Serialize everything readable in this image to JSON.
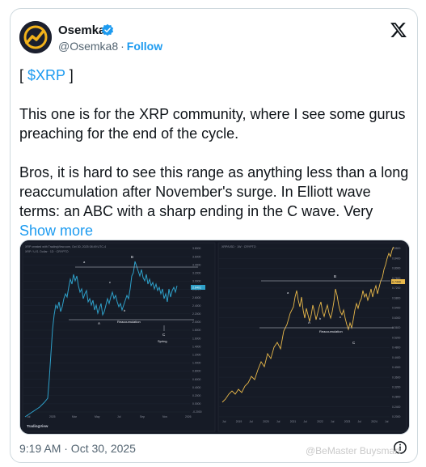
{
  "author": {
    "name": "Osemka",
    "handle": "@Osemka8",
    "separator": "·",
    "follow_label": "Follow"
  },
  "tweet": {
    "cashtag_open": "[ ",
    "cashtag": "$XRP",
    "cashtag_close": " ]",
    "paragraph_1": "This one is for the XRP community, where I see some gurus preaching for the end of the cycle.",
    "paragraph_2": "Bros, it is hard to see this range as anything less than a long reaccumulation after November's surge. In Elliott wave terms: an ABC with a sharp ending in the C wave. Very ",
    "show_more_label": "Show more"
  },
  "timestamp": "9:19 AM · Oct 30, 2025",
  "watermark": "@BeMaster Buysmart",
  "chart_left": {
    "header": "XRP created with TradingView.com, Oct 30, 2025 08:49 UTC-4",
    "symbol": "XRP / U.S. Dollar · 1D · CRYPTO",
    "labels": {
      "A": "A",
      "B": "B",
      "C": "C",
      "a": "a",
      "b": "b",
      "c": "c",
      "reacc": "Reaccumulation",
      "spring": "Spring"
    },
    "x_ticks": [
      "Jul",
      "2025",
      "Mar",
      "May",
      "Jul",
      "Sep",
      "Nov",
      "2026"
    ],
    "y_ticks": [
      "3.8000",
      "3.6000",
      "3.4000",
      "3.2000",
      "3.0000",
      "2.8000",
      "2.6000",
      "2.4000",
      "2.2000",
      "2.0000",
      "1.8000",
      "1.6000",
      "1.4000",
      "1.2000",
      "1.0000",
      "0.8000",
      "0.6000",
      "0.4000",
      "0.2000",
      "0.0000",
      "-0.2000"
    ],
    "price_tag": "2.6401",
    "brand": "TradingView"
  },
  "chart_right": {
    "header": "XRP/USD · 1W · CRYPTO",
    "labels": {
      "A": "A",
      "B": "B",
      "C": "C",
      "a": "a",
      "b": "b",
      "c": "c",
      "reacc": "Reaccumulation"
    },
    "x_ticks": [
      "Jul",
      "2019",
      "Jul",
      "2020",
      "Jul",
      "2021",
      "Jul",
      "2022",
      "Jul",
      "2023",
      "Jul",
      "2024",
      "Jul"
    ],
    "y_ticks": [
      "0.8800",
      "0.8400",
      "0.8000",
      "0.7600",
      "0.7200",
      "0.6800",
      "0.6400",
      "0.6000",
      "0.5600",
      "0.5200",
      "0.4800",
      "0.4400",
      "0.4000",
      "0.3600",
      "0.3200",
      "0.2800",
      "0.2400",
      "0.2000"
    ],
    "price_tag": "0.7440"
  }
}
